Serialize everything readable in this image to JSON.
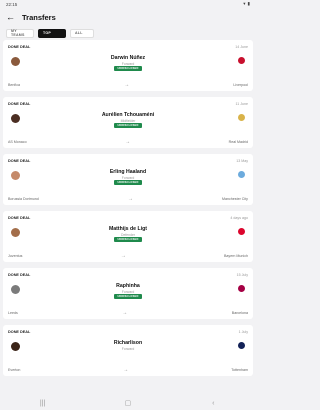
{
  "status_bar": {
    "time": "22:15"
  },
  "header": {
    "title": "Transfers"
  },
  "filters": [
    {
      "label": "MY TEAMS",
      "selected": false
    },
    {
      "label": "TOP",
      "selected": true
    },
    {
      "label": "ALL",
      "selected": false
    }
  ],
  "transfers": [
    {
      "status": "DONE DEAL",
      "date": "14 June",
      "player": "Darwin Núñez",
      "position": "Forward",
      "fee": "UNDISCLOSED",
      "from": "Benfica",
      "to": "Liverpool",
      "avatar_color": "#8a5a3c",
      "club_color": "#c8102e"
    },
    {
      "status": "DONE DEAL",
      "date": "11 June",
      "player": "Aurélien Tchouaméni",
      "position": "Midfielder",
      "fee": "UNDISCLOSED",
      "from": "AS Monaco",
      "to": "Real Madrid",
      "avatar_color": "#4b2e22",
      "club_color": "#d9b34a"
    },
    {
      "status": "DONE DEAL",
      "date": "13 May",
      "player": "Erling Haaland",
      "position": "Forward",
      "fee": "UNDISCLOSED",
      "from": "Borussia Dortmund",
      "to": "Manchester City",
      "avatar_color": "#c58a6a",
      "club_color": "#6cabdd"
    },
    {
      "status": "DONE DEAL",
      "date": "4 days ago",
      "player": "Matthijs de Ligt",
      "position": "Defender",
      "fee": "UNDISCLOSED",
      "from": "Juventus",
      "to": "Bayern Munich",
      "avatar_color": "#a36e4a",
      "club_color": "#dc052d"
    },
    {
      "status": "DONE DEAL",
      "date": "15 July",
      "player": "Raphinha",
      "position": "Forward",
      "fee": "UNDISCLOSED",
      "from": "Leeds",
      "to": "Barcelona",
      "avatar_color": "#7b7b7b",
      "club_color": "#a50044"
    },
    {
      "status": "DONE DEAL",
      "date": "1 July",
      "player": "Richarlison",
      "position": "Forward",
      "fee": "",
      "from": "Everton",
      "to": "Tottenham",
      "avatar_color": "#3b2418",
      "club_color": "#132257"
    }
  ],
  "transfer_arrow": "→",
  "colors": {
    "fee_badge": "#1f8a4c",
    "chip_selected": "#111111"
  }
}
